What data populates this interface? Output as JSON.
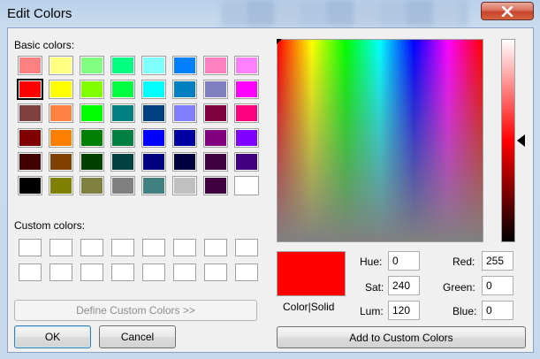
{
  "window": {
    "title": "Edit Colors"
  },
  "basic_colors_label": "Basic colors:",
  "custom_colors_label": "Custom colors:",
  "basic_colors": [
    [
      "#ff8080",
      "#ffff80",
      "#80ff80",
      "#00ff80",
      "#80ffff",
      "#0080ff",
      "#ff80c0",
      "#ff80ff"
    ],
    [
      "#ff0000",
      "#ffff00",
      "#80ff00",
      "#00ff40",
      "#00ffff",
      "#0080c0",
      "#8080c0",
      "#ff00ff"
    ],
    [
      "#804040",
      "#ff8040",
      "#00ff00",
      "#008080",
      "#004080",
      "#8080ff",
      "#800040",
      "#ff0080"
    ],
    [
      "#800000",
      "#ff8000",
      "#008000",
      "#008040",
      "#0000ff",
      "#0000a0",
      "#800080",
      "#8000ff"
    ],
    [
      "#400000",
      "#804000",
      "#004000",
      "#004040",
      "#000080",
      "#000040",
      "#400040",
      "#400080"
    ],
    [
      "#000000",
      "#808000",
      "#808040",
      "#808080",
      "#408080",
      "#c0c0c0",
      "#400040",
      "#ffffff"
    ]
  ],
  "buttons": {
    "define_custom": "Define Custom Colors >>",
    "ok": "OK",
    "cancel": "Cancel",
    "add_custom": "Add to Custom Colors"
  },
  "preview_label": "Color|Solid",
  "fields": {
    "hue_label": "Hue:",
    "hue": "0",
    "sat_label": "Sat:",
    "sat": "240",
    "lum_label": "Lum:",
    "lum": "120",
    "red_label": "Red:",
    "red": "255",
    "green_label": "Green:",
    "green": "0",
    "blue_label": "Blue:",
    "blue": "0"
  },
  "icons": {
    "close": "close-icon"
  }
}
